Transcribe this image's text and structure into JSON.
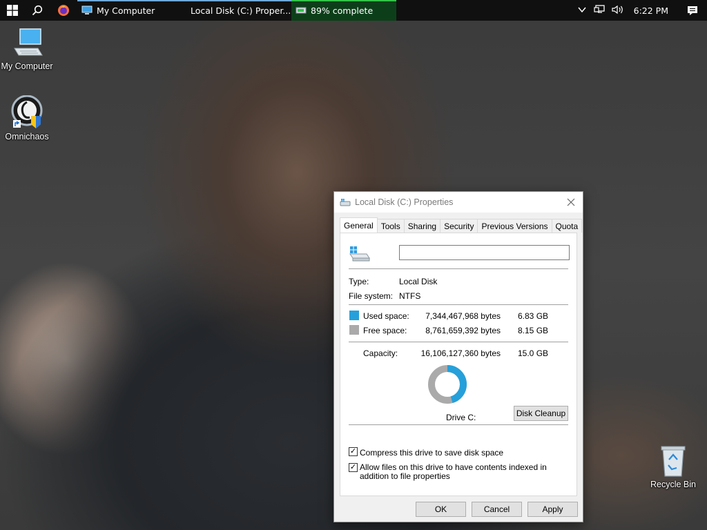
{
  "taskbar": {
    "tasks": [
      {
        "label": "My Computer",
        "icon": "computer-icon"
      },
      {
        "label": "Local Disk (C:) Proper...",
        "icon": "drive-icon"
      },
      {
        "label": "89% complete",
        "icon": "copy-progress-icon",
        "progress": 0.89
      }
    ],
    "clock": "6:22 PM"
  },
  "desktop": {
    "icons": [
      {
        "label": "My Computer"
      },
      {
        "label": "Omnichaos"
      },
      {
        "label": "Recycle Bin"
      }
    ]
  },
  "dialog": {
    "title": "Local Disk (C:) Properties",
    "tabs": [
      "General",
      "Tools",
      "Sharing",
      "Security",
      "Previous Versions",
      "Quota"
    ],
    "active_tab": "General",
    "name_value": "",
    "type_label": "Type:",
    "type_value": "Local Disk",
    "fs_label": "File system:",
    "fs_value": "NTFS",
    "used_label": "Used space:",
    "used_bytes": "7,344,467,968 bytes",
    "used_gb": "6.83 GB",
    "free_label": "Free space:",
    "free_bytes": "8,761,659,392 bytes",
    "free_gb": "8.15 GB",
    "capacity_label": "Capacity:",
    "capacity_bytes": "16,106,127,360 bytes",
    "capacity_gb": "15.0 GB",
    "drive_label": "Drive C:",
    "cleanup_button": "Disk Cleanup",
    "compress_label": "Compress this drive to save disk space",
    "compress_checked": true,
    "index_label": "Allow files on this drive to have contents indexed in addition to file properties",
    "index_checked": true,
    "ok_button": "OK",
    "cancel_button": "Cancel",
    "apply_button": "Apply",
    "used_fraction": 0.456,
    "colors": {
      "used": "#26a0da",
      "free": "#aaaaaa"
    }
  }
}
